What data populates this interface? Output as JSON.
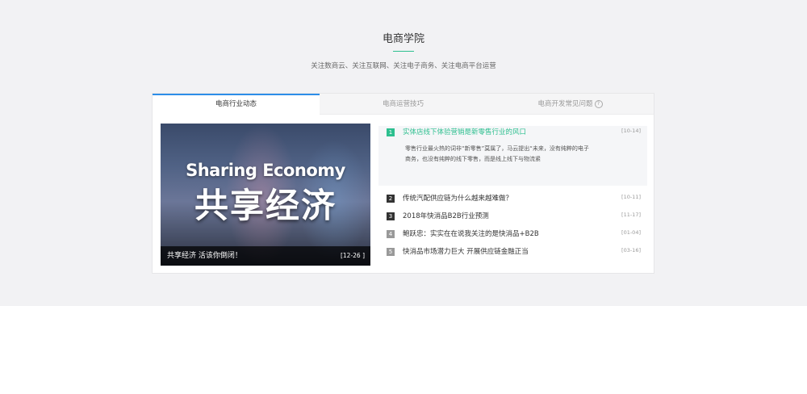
{
  "header": {
    "title": "电商学院",
    "subtitle": "关注数商云、关注互联网、关注电子商务、关注电商平台运营"
  },
  "tabs": [
    {
      "label": "电商行业动态"
    },
    {
      "label": "电商运营技巧"
    },
    {
      "label": "电商开发常见问题"
    }
  ],
  "feature": {
    "image_text_en": "Sharing Economy",
    "image_text_cn": "共享经济",
    "caption": "共享经济 活该你倒闭！",
    "date": "[12-26 ]"
  },
  "news": [
    {
      "num": "1",
      "title": "实体店线下体验营销是新零售行业的风口",
      "date": "[10-14]",
      "desc": "零售行业最火热的词非“新零售”莫属了，马云提出“未来，没有纯粹的电子商务，也没有纯粹的线下零售，而是线上线下与物流紧"
    },
    {
      "num": "2",
      "title": "传统汽配供应链为什么越来越难做？",
      "date": "[10-11]"
    },
    {
      "num": "3",
      "title": "2018年快消品B2B行业预测",
      "date": "[11-17]"
    },
    {
      "num": "4",
      "title": "鲍跃忠：实实在在说我关注的是快消品+B2B",
      "date": "[01-04]"
    },
    {
      "num": "5",
      "title": "快消品市场潜力巨大 开展供应链金融正当",
      "date": "[03-16]"
    }
  ],
  "colors": {
    "accent": "#2dbf8f",
    "tab_active": "#2c8de8",
    "background": "#f2f2f4"
  },
  "icons": {
    "help": "question-circle-icon"
  }
}
